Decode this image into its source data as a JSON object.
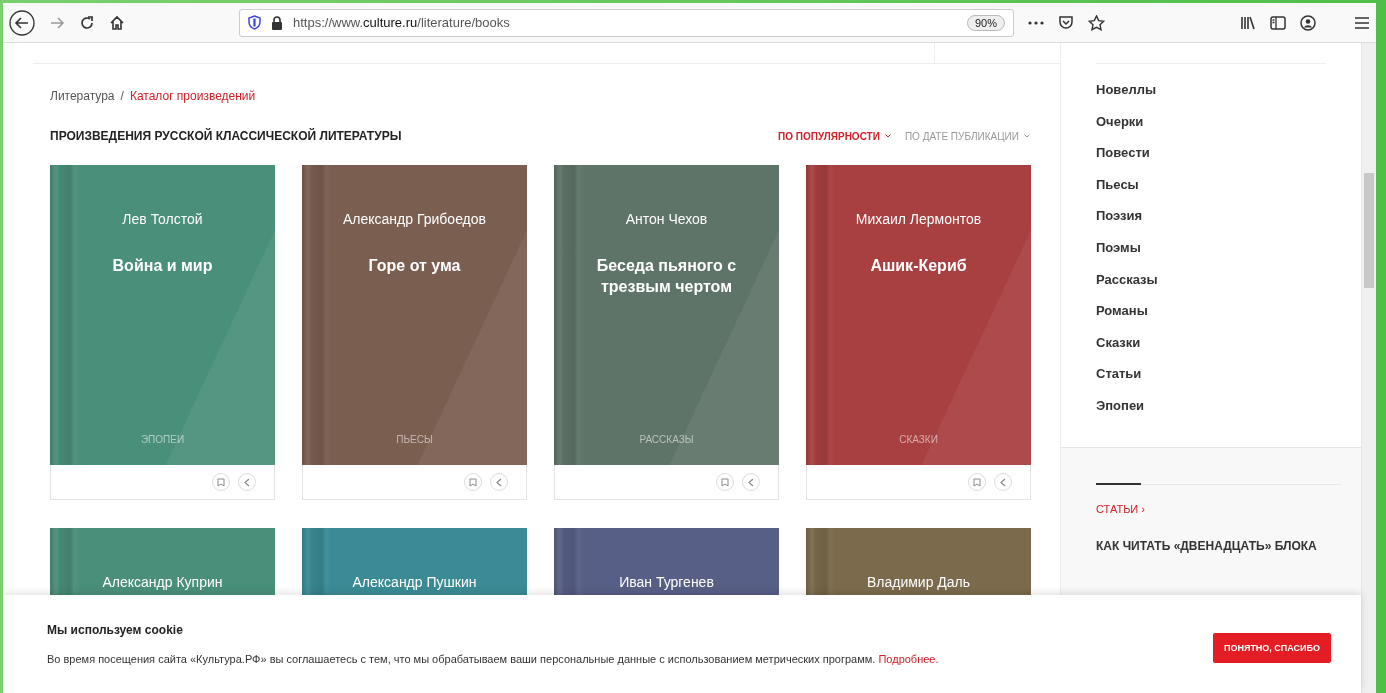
{
  "browser": {
    "url_prefix": "https://www.",
    "url_domain": "culture.ru",
    "url_path": "/literature/books",
    "zoom": "90%"
  },
  "breadcrumb_separator": "/",
  "breadcrumb": [
    {
      "label": "Литература",
      "current": false
    },
    {
      "label": "Каталог произведений",
      "current": true
    }
  ],
  "heading": "ПРОИЗВЕДЕНИЯ РУССКОЙ КЛАССИЧЕСКОЙ ЛИТЕРАТУРЫ",
  "sort_options": [
    {
      "label": "ПО ПОПУЛЯРНОСТИ",
      "selected": true
    },
    {
      "label": "ПО ДАТЕ ПУБЛИКАЦИИ",
      "selected": false
    }
  ],
  "books": [
    {
      "author": "Лев Толстой",
      "title": "Война и мир",
      "genre": "ЭПОПЕИ",
      "color": "#4a8f7a"
    },
    {
      "author": "Александр Грибоедов",
      "title": "Горе от ума",
      "genre": "ПЬЕСЫ",
      "color": "#7a5e50"
    },
    {
      "author": "Антон Чехов",
      "title": "Беседа пьяного с трезвым чертом",
      "genre": "РАССКАЗЫ",
      "color": "#5f7468"
    },
    {
      "author": "Михаил Лермонтов",
      "title": "Ашик-Кериб",
      "genre": "СКАЗКИ",
      "color": "#a83f40"
    },
    {
      "author": "Александр Куприн",
      "color": "#4a8f7a"
    },
    {
      "author": "Александр Пушкин",
      "color": "#3a8b95"
    },
    {
      "author": "Иван Тургенев",
      "color": "#585f86"
    },
    {
      "author": "Владимир Даль",
      "color": "#7b6a4c"
    }
  ],
  "sidebar": {
    "genres": [
      "Новеллы",
      "Очерки",
      "Повести",
      "Пьесы",
      "Поэзия",
      "Поэмы",
      "Рассказы",
      "Романы",
      "Сказки",
      "Статьи",
      "Эпопеи"
    ],
    "articles_link": "СТАТЬИ ›",
    "article_title": "КАК ЧИТАТЬ «ДВЕНАДЦАТЬ» БЛОКА"
  },
  "cookie": {
    "title": "Мы используем cookie",
    "text": "Во время посещения сайта «Культура.РФ» вы соглашаетесь с тем, что мы обрабатываем ваши персональные данные с использованием метрических программ.",
    "link": "Подробнее.",
    "button": "ПОНЯТНО, СПАСИБО"
  }
}
